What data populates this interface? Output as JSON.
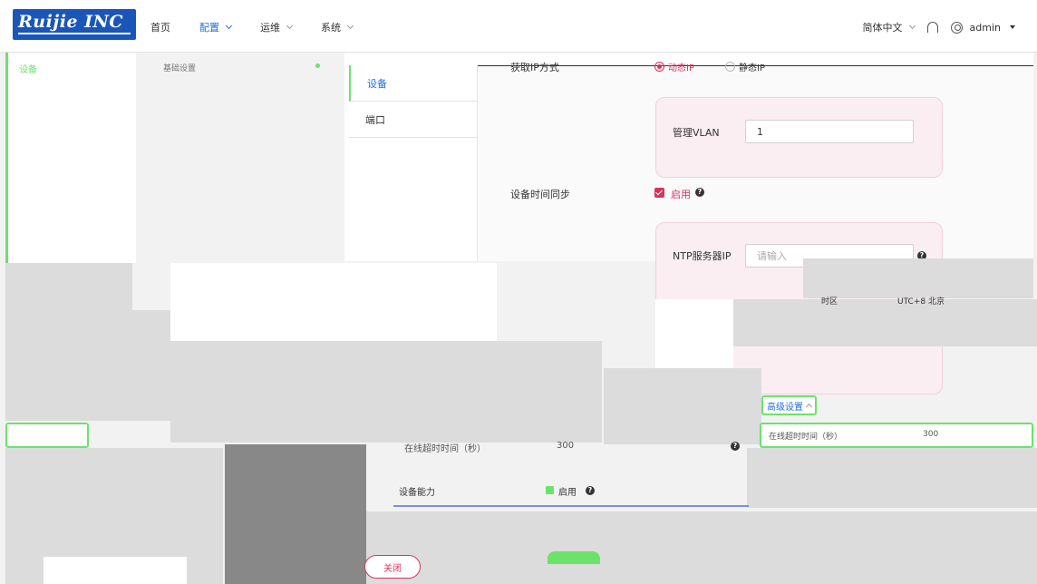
{
  "header": {
    "logo_text": "Ruijie INC",
    "nav": [
      {
        "label": "首页",
        "active": false
      },
      {
        "label": "配置",
        "active": true
      },
      {
        "label": "运维",
        "active": false
      },
      {
        "label": "系统",
        "active": false
      }
    ],
    "language": "简体中文",
    "user": "admin"
  },
  "sidebar": {
    "item": "设备",
    "sub": "基础设置"
  },
  "tabs": [
    {
      "label": "设备",
      "active": true
    },
    {
      "label": "端口",
      "active": false
    }
  ],
  "form": {
    "ip_mode_label": "获取IP方式",
    "ip_mode_dynamic": "动态IP",
    "ip_mode_static": "静态IP",
    "vlan_label": "管理VLAN",
    "vlan_value": "1",
    "time_sync_label": "设备时间同步",
    "time_sync_enable": "启用",
    "ntp_label": "NTP服务器IP",
    "ntp_placeholder": "请输入",
    "timezone_label": "时区",
    "timezone_value": "UTC+8 北京",
    "advanced_label": "高级设置",
    "timeout_label": "在线超时时间（秒）",
    "timeout_value": "300",
    "timeout_value_2": "300",
    "capability_label": "设备能力",
    "capability_enable": "启用",
    "close_button": "关闭"
  },
  "colors": {
    "accent_blue": "#1f6fe0",
    "accent_pink": "#d8335a",
    "highlight_green": "#6be36b",
    "card_bg": "#fbeef2"
  }
}
